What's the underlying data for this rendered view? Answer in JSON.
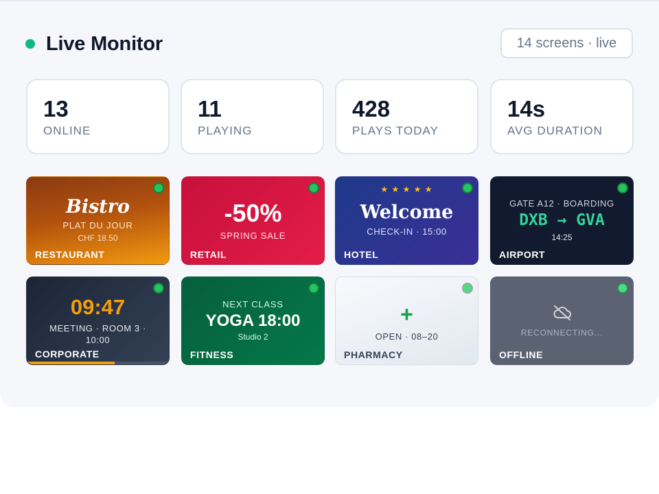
{
  "header": {
    "title": "Live Monitor",
    "screens_pill": "14 screens · live"
  },
  "stats": [
    {
      "value": "13",
      "label": "ONLINE"
    },
    {
      "value": "11",
      "label": "PLAYING"
    },
    {
      "value": "428",
      "label": "PLAYS TODAY"
    },
    {
      "value": "14s",
      "label": "AVG DURATION"
    }
  ],
  "tiles": {
    "restaurant": {
      "heading": "Bistro",
      "line1": "PLAT DU JOUR",
      "line2": "CHF 18.50",
      "label": "RESTAURANT"
    },
    "retail": {
      "heading": "-50%",
      "line1": "SPRING SALE",
      "label": "RETAIL"
    },
    "hotel": {
      "stars": "★ ★ ★ ★ ★",
      "heading": "Welcome",
      "line1": "CHECK-IN · 15:00",
      "label": "HOTEL"
    },
    "airport": {
      "line1": "GATE A12 · BOARDING",
      "route": "DXB → GVA",
      "time": "14:25",
      "label": "AIRPORT"
    },
    "corporate": {
      "heading": "09:47",
      "line1": "MEETING · ROOM 3 ·",
      "line2": "10:00",
      "label": "CORPORATE",
      "progress": 0.62
    },
    "fitness": {
      "line1": "NEXT CLASS",
      "heading": "YOGA 18:00",
      "line2": "Studio 2",
      "label": "FITNESS"
    },
    "pharmacy": {
      "icon": "+",
      "line1": "OPEN · 08–20",
      "label": "PHARMACY"
    },
    "offline": {
      "line1": "RECONNECTING...",
      "label": "OFFLINE"
    }
  },
  "colors": {
    "live": "#10b981",
    "status_online": "#22c55e",
    "status_pharmacy": "#4ade80",
    "corporate_accent": "#f59e0b"
  },
  "icons": [
    "live-status-dot",
    "status-dot",
    "pharmacy-cross-icon",
    "cloud-off-icon"
  ]
}
